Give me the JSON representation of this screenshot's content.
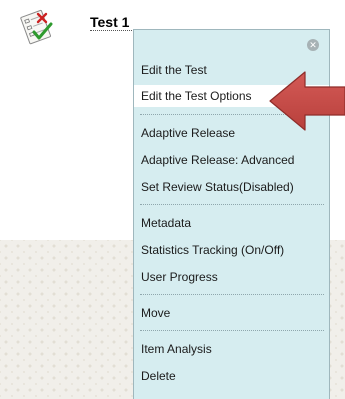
{
  "item": {
    "title": "Test 1",
    "icon": "test-checklist-icon"
  },
  "menu": {
    "close_icon": "close-circle-icon",
    "close_glyph": "✕",
    "groups": [
      {
        "items": [
          {
            "label": "Edit the Test",
            "highlighted": false
          },
          {
            "label": "Edit the Test Options",
            "highlighted": true
          }
        ]
      },
      {
        "items": [
          {
            "label": "Adaptive Release",
            "highlighted": false
          },
          {
            "label": "Adaptive Release: Advanced",
            "highlighted": false
          },
          {
            "label": "Set Review Status(Disabled)",
            "highlighted": false
          }
        ]
      },
      {
        "items": [
          {
            "label": "Metadata",
            "highlighted": false
          },
          {
            "label": "Statistics Tracking (On/Off)",
            "highlighted": false
          },
          {
            "label": "User Progress",
            "highlighted": false
          }
        ]
      },
      {
        "items": [
          {
            "label": "Move",
            "highlighted": false
          }
        ]
      },
      {
        "items": [
          {
            "label": "Item Analysis",
            "highlighted": false
          },
          {
            "label": "Delete",
            "highlighted": false
          }
        ]
      }
    ]
  },
  "colors": {
    "menu_background": "#d6edf0",
    "highlight_background": "#ffffff",
    "arrow_red": "#c0504d"
  }
}
